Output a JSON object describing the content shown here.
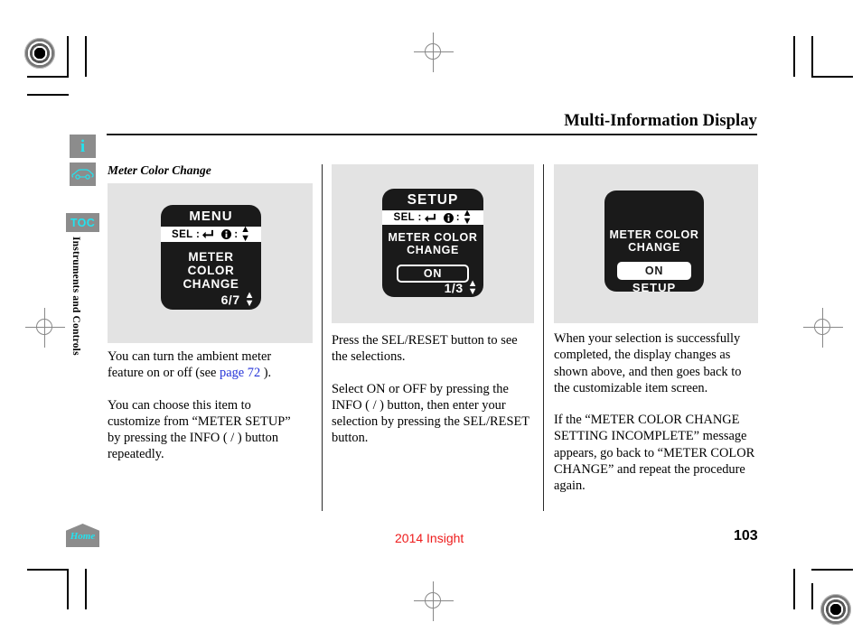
{
  "header": {
    "title": "Multi-Information Display"
  },
  "sidebar": {
    "info_button": {
      "icon": "info-icon",
      "glyph": "i"
    },
    "vehicle_button": {
      "icon": "car-icon"
    },
    "toc_button": {
      "label": "TOC"
    },
    "section_label": "Instruments and Controls",
    "home_button": {
      "label": "Home",
      "icon": "home-icon"
    }
  },
  "columns": {
    "left": {
      "subheading": "Meter Color Change",
      "display": {
        "title": "MENU",
        "sel_label": "SEL :",
        "sel_icon": "enter-arrow-icon",
        "info_icon": "info-circle-icon",
        "info_label": ":",
        "updown_icon": "up-down-arrow-icon",
        "item": "METER COLOR CHANGE",
        "page_indicator": "6/7"
      },
      "paragraphs": [
        {
          "parts": [
            {
              "text": "You can turn the ambient meter feature on or off (see "
            },
            {
              "text": "page  72",
              "link": true
            },
            {
              "text": "  )."
            }
          ]
        },
        {
          "parts": [
            {
              "text": "You can choose this item to customize from “METER SETUP” by pressing the INFO (    /    ) button  repeatedly."
            }
          ]
        }
      ]
    },
    "middle": {
      "display": {
        "title": "SETUP",
        "sel_label": "SEL :",
        "sel_icon": "enter-arrow-icon",
        "info_icon": "info-circle-icon",
        "info_label": ":",
        "updown_icon": "up-down-arrow-icon",
        "item": "METER COLOR CHANGE",
        "button": "ON",
        "page_indicator": "1/3"
      },
      "paragraphs": [
        {
          "text": "Press the SEL/RESET button to see the selections."
        },
        {
          "text": "Select ON or OFF by pressing the INFO (    /    ) button, then enter your selection by pressing the SEL/RESET button."
        }
      ]
    },
    "right": {
      "display": {
        "item": "METER COLOR CHANGE",
        "button": "ON",
        "footer": "SETUP"
      },
      "paragraphs": [
        {
          "text": "When your selection is successfully completed, the display changes as shown above, and then goes back to the customizable item screen."
        },
        {
          "text": "If the “METER COLOR CHANGE SETTING INCOMPLETE” message appears, go back to “METER COLOR CHANGE” and repeat the procedure again."
        }
      ]
    }
  },
  "footer": {
    "model": "2014 Insight",
    "page_number": "103"
  },
  "colors": {
    "accent_cyan": "#23e3ef",
    "link_blue": "#2433d8",
    "footer_red": "#ee1b1b",
    "image_bg": "#e3e3e3",
    "lcd_bg": "#1a1a1a"
  }
}
